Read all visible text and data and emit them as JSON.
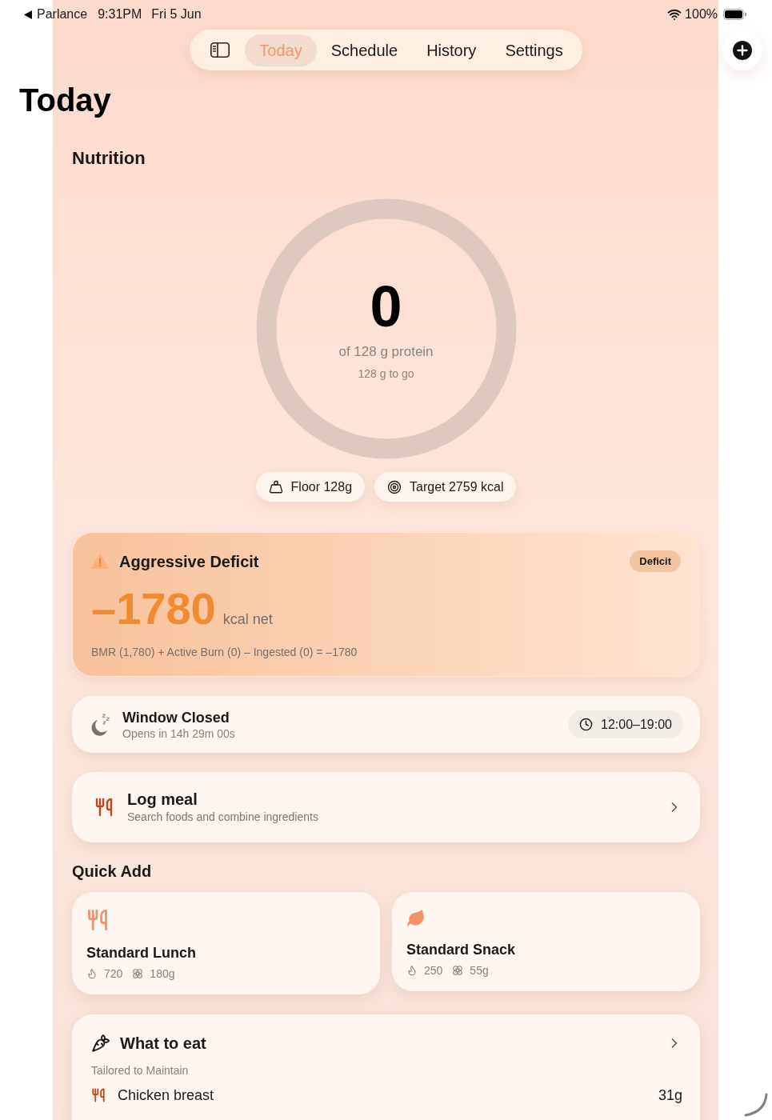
{
  "status_bar": {
    "back_label": "Parlance",
    "time": "9:31PM",
    "date": "Fri 5 Jun",
    "battery": "100%"
  },
  "tab_bar": {
    "sidebar_button": {
      "selected": false
    },
    "tabs": [
      {
        "label": "Today",
        "selected": true
      },
      {
        "label": "Schedule",
        "selected": false
      },
      {
        "label": "History",
        "selected": false
      },
      {
        "label": "Settings",
        "selected": false
      }
    ]
  },
  "page_title": "Today",
  "nutrition": {
    "heading": "Nutrition",
    "ring": {
      "value": "0",
      "caption": "of 128 g protein",
      "remaining": "128 g to go"
    },
    "chips": [
      {
        "kind": "floor",
        "label": "Floor 128g"
      },
      {
        "kind": "target",
        "label": "Target 2759 kcal"
      }
    ]
  },
  "deficit_card": {
    "title": "Aggressive Deficit",
    "badge": "Deficit",
    "value": "–1780",
    "unit": "kcal net",
    "formula": "BMR (1,780) + Active Burn (0) – Ingested (0) = –1780"
  },
  "window_card": {
    "title": "Window Closed",
    "subtitle": "Opens in 14h 29m 00s",
    "hours": "12:00–19:00"
  },
  "log_meal": {
    "title": "Log meal",
    "subtitle": "Search foods and combine ingredients"
  },
  "quick_add": {
    "heading": "Quick Add",
    "items": [
      {
        "kind": "meal",
        "name": "Standard Lunch",
        "calories": "720",
        "weight": "180g"
      },
      {
        "kind": "snack",
        "name": "Standard Snack",
        "calories": "250",
        "weight": "55g"
      }
    ]
  },
  "what_to_eat": {
    "title": "What to eat",
    "subtitle": "Tailored to Maintain",
    "foods": [
      {
        "name": "Chicken breast",
        "amount": "31g"
      }
    ]
  }
}
